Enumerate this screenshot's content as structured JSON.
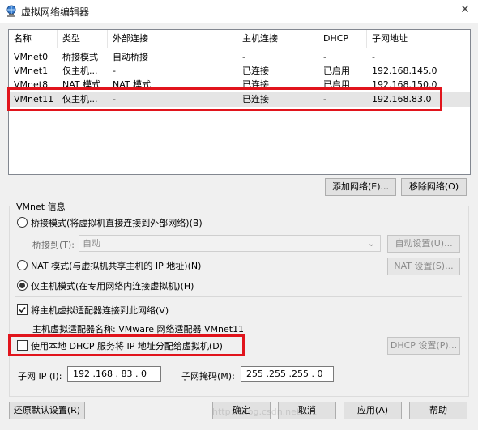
{
  "window": {
    "title": "虚拟网络编辑器",
    "close_glyph": "✕"
  },
  "table": {
    "columns": [
      "名称",
      "类型",
      "外部连接",
      "主机连接",
      "DHCP",
      "子网地址"
    ],
    "rows": [
      {
        "name": "VMnet0",
        "type": "桥接模式",
        "external": "自动桥接",
        "host": "-",
        "dhcp": "-",
        "subnet": "-"
      },
      {
        "name": "VMnet1",
        "type": "仅主机...",
        "external": "-",
        "host": "已连接",
        "dhcp": "已启用",
        "subnet": "192.168.145.0"
      },
      {
        "name": "VMnet8",
        "type": "NAT 模式",
        "external": "NAT 模式",
        "host": "已连接",
        "dhcp": "已启用",
        "subnet": "192.168.150.0"
      },
      {
        "name": "VMnet11",
        "type": "仅主机...",
        "external": "-",
        "host": "已连接",
        "dhcp": "-",
        "subnet": "192.168.83.0"
      }
    ]
  },
  "buttons": {
    "add_network": "添加网络(E)...",
    "remove_network": "移除网络(O)",
    "auto_settings": "自动设置(U)...",
    "nat_settings": "NAT 设置(S)...",
    "dhcp_settings": "DHCP 设置(P)...",
    "restore_defaults": "还原默认设置(R)",
    "ok": "确定",
    "cancel": "取消",
    "apply": "应用(A)",
    "help": "帮助"
  },
  "vmnet_info": {
    "group_label": "VMnet 信息",
    "bridged_label": "桥接模式(将虚拟机直接连接到外部网络)(B)",
    "bridged_to_label": "桥接到(T):",
    "bridged_to_value": "自动",
    "nat_label": "NAT 模式(与虚拟机共享主机的 IP 地址)(N)",
    "host_only_label": "仅主机模式(在专用网络内连接虚拟机)(H)",
    "selected_mode": "host_only",
    "connect_adapter_label": "将主机虚拟适配器连接到此网络(V)",
    "connect_adapter_checked": true,
    "adapter_name_label": "主机虚拟适配器名称: VMware 网络适配器 VMnet11",
    "use_dhcp_label": "使用本地 DHCP 服务将 IP 地址分配给虚拟机(D)",
    "use_dhcp_checked": false,
    "subnet_ip_label": "子网 IP (I):",
    "subnet_ip_value": "192 .168 . 83 . 0",
    "subnet_mask_label": "子网掩码(M):",
    "subnet_mask_value": "255 .255 .255 . 0"
  },
  "watermark": "http://blog.csdn.net/...1",
  "colors": {
    "highlight_box": "#e1141c",
    "selected_row": "#e5e5e5"
  }
}
